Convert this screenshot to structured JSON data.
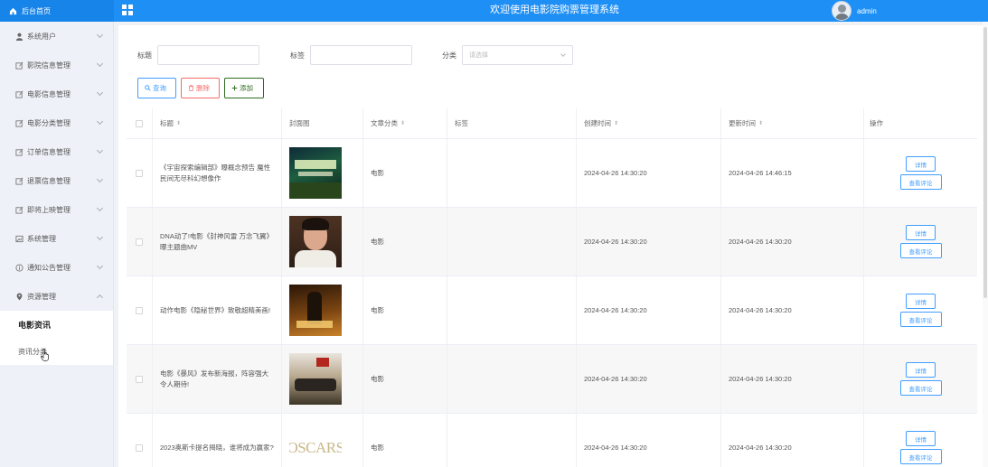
{
  "header": {
    "home_label": "后台首页",
    "title": "欢迎使用电影院购票管理系统",
    "username": "admin",
    "icons": {
      "home": "home-icon",
      "apps": "grid-icon"
    }
  },
  "sidebar": {
    "items": [
      {
        "label": "系统用户",
        "icon": "user-icon"
      },
      {
        "label": "影院信息管理",
        "icon": "edit-icon"
      },
      {
        "label": "电影信息管理",
        "icon": "edit-icon"
      },
      {
        "label": "电影分类管理",
        "icon": "edit-icon"
      },
      {
        "label": "订单信息管理",
        "icon": "edit-icon"
      },
      {
        "label": "退票信息管理",
        "icon": "edit-icon"
      },
      {
        "label": "即将上映管理",
        "icon": "edit-icon"
      },
      {
        "label": "系统管理",
        "icon": "picture-icon"
      },
      {
        "label": "通知公告管理",
        "icon": "info-icon"
      },
      {
        "label": "资源管理",
        "icon": "location-icon"
      }
    ],
    "sub_items": [
      {
        "label": "电影资讯",
        "active": true
      },
      {
        "label": "资讯分类",
        "active": false
      }
    ]
  },
  "filters": {
    "title_label": "标题",
    "tags_label": "标签",
    "category_label": "分类",
    "category_placeholder": "请选择"
  },
  "actions": {
    "query": "查询",
    "delete": "删除",
    "add": "添加"
  },
  "table": {
    "headers": {
      "title": "标题",
      "cover": "封面图",
      "category": "文章分类",
      "tags": "标签",
      "created": "创建时间",
      "updated": "更新时间",
      "ops": "操作"
    },
    "detail_label": "详情",
    "review_label": "查看评论",
    "rows": [
      {
        "title": "《宇宙探索编辑部》曝概念预告 魔性民间无尽科幻想像作",
        "cover_text": "",
        "category": "电影",
        "tags": "",
        "created": "2024-04-26 14:30:20",
        "updated": "2024-04-26 14:46:15"
      },
      {
        "title": "DNA动了!电影《封神风雷 万念飞翼》曝主题曲MV",
        "cover_text": "",
        "category": "电影",
        "tags": "",
        "created": "2024-04-26 14:30:20",
        "updated": "2024-04-26 14:30:20"
      },
      {
        "title": "动作电影《隐秘世界》致敬超精美画!",
        "cover_text": "",
        "category": "电影",
        "tags": "",
        "created": "2024-04-26 14:30:20",
        "updated": "2024-04-26 14:30:20"
      },
      {
        "title": "电影《暴风》发布新海报，阵容强大令人期待!",
        "cover_text": "",
        "category": "电影",
        "tags": "",
        "created": "2024-04-26 14:30:20",
        "updated": "2024-04-26 14:30:20"
      },
      {
        "title": "2023奥斯卡提名揭晓，谁将成为赢家?",
        "cover_text": "OSCARS",
        "category": "电影",
        "tags": "",
        "created": "2024-04-26 14:30:20",
        "updated": "2024-04-26 14:30:20"
      }
    ]
  }
}
